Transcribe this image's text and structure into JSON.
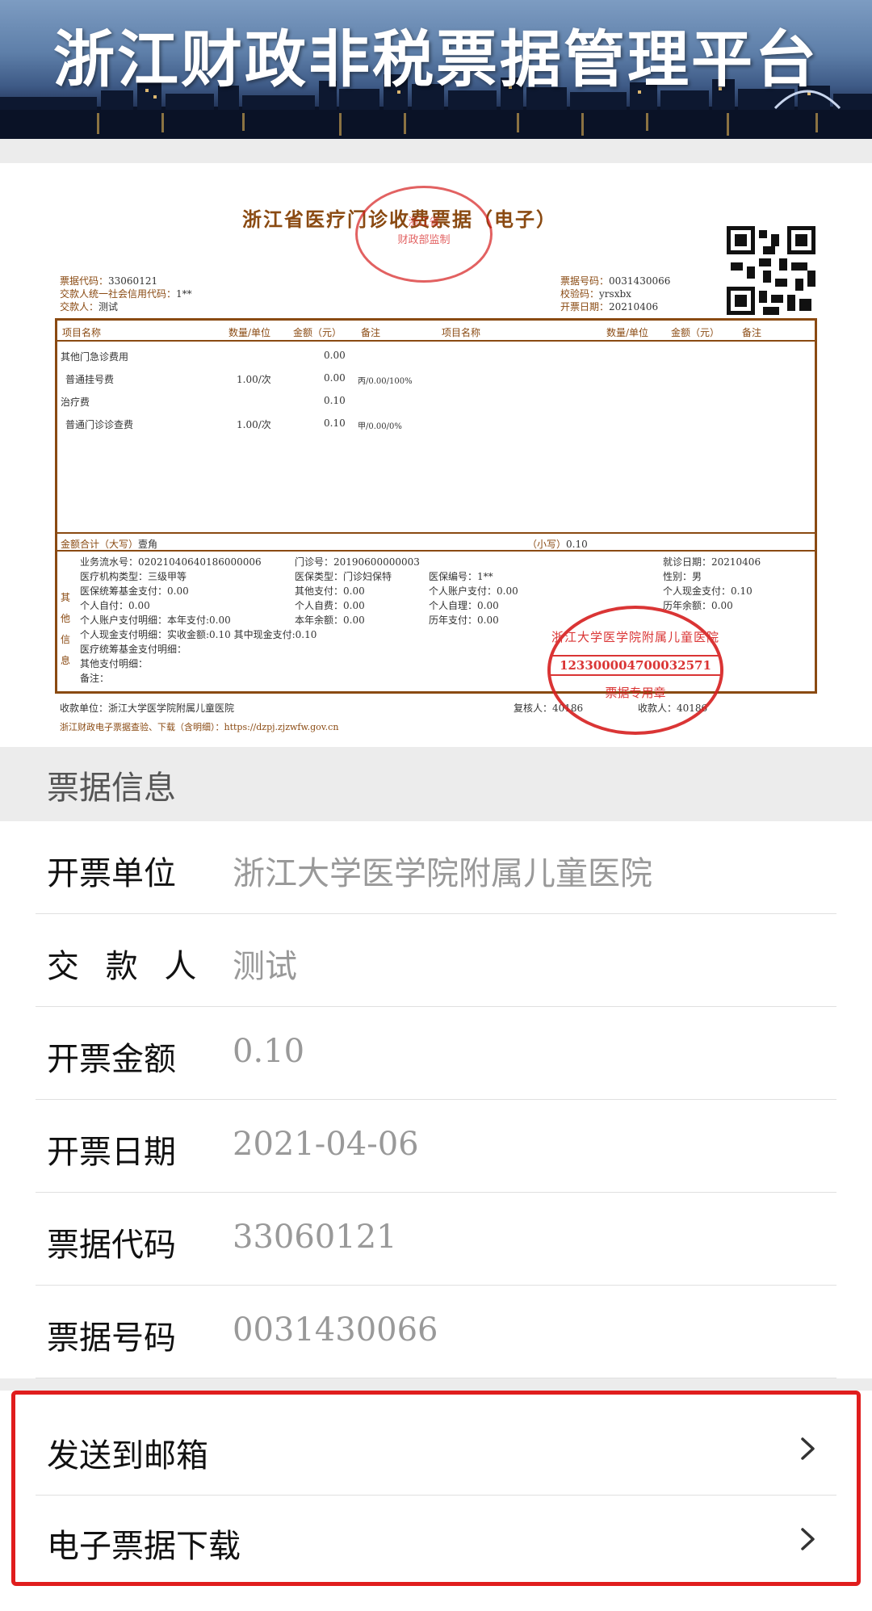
{
  "header": {
    "title": "浙江财政非税票据管理平台"
  },
  "receipt": {
    "title": "浙江省医疗门诊收费票据（电子）",
    "seal_top": {
      "text": "浙江省\n财政部监制"
    },
    "left_meta": [
      {
        "k": "票据代码：",
        "v": "33060121"
      },
      {
        "k": "交款人统一社会信用代码：",
        "v": "1**"
      },
      {
        "k": "交款人：",
        "v": "测试"
      }
    ],
    "right_meta": [
      {
        "k": "票据号码：",
        "v": "0031430066"
      },
      {
        "k": "校验码：",
        "v": "yrsxbx"
      },
      {
        "k": "开票日期：",
        "v": "20210406"
      }
    ],
    "table_headers": {
      "item": "项目名称",
      "qty": "数量/单位",
      "amount": "金额（元）",
      "note": "备注",
      "item2": "项目名称",
      "qty2": "数量/单位",
      "amount2": "金额（元）",
      "note2": "备注"
    },
    "rows": [
      {
        "name": "其他门急诊费用",
        "qty": "",
        "amount": "0.00",
        "note": ""
      },
      {
        "name": " 普通挂号费",
        "qty": "1.00/次",
        "amount": "0.00",
        "note": "丙/0.00/100%"
      },
      {
        "name": "治疗费",
        "qty": "",
        "amount": "0.10",
        "note": ""
      },
      {
        "name": " 普通门诊诊查费",
        "qty": "1.00/次",
        "amount": "0.10",
        "note": "甲/0.00/0%"
      }
    ],
    "total_upper_label": "金额合计（大写）",
    "total_upper": "壹角",
    "total_lower_label": "（小写）",
    "total_lower": "0.10",
    "other_label": "其他信息",
    "other_lines": [
      "业务流水号：02021040640186000006",
      "医疗机构类型：三级甲等",
      "医保统筹基金支付：0.00",
      "个人自付：0.00",
      "个人账户支付明细：本年支付:0.00",
      "个人现金支付明细：实收金额:0.10  其中现金支付:0.10",
      "医疗统筹基金支付明细：",
      "其他支付明细：",
      "备注："
    ],
    "mid_lines": [
      "门诊号：20190600000003",
      "医保类型：门诊妇保特",
      "其他支付：0.00",
      "个人自费：0.00",
      "本年余额：0.00"
    ],
    "mid2_lines": [
      "医保编号：1**",
      "个人账户支付：0.00",
      "个人自理：0.00",
      "历年支付：0.00"
    ],
    "right_lines": [
      "就诊日期：20210406",
      "性别：男",
      "个人现金支付：0.10",
      "历年余额：0.00"
    ],
    "payee": "收款单位：浙江大学医学院附属儿童医院",
    "reviewer": "复核人：40186",
    "issuer": "收款人：40186",
    "footer": "浙江财政电子票据查验、下载（含明细）：https://dzpj.zjzwfw.gov.cn",
    "seal_bottom": {
      "text": "浙江大学医学院附属儿童医院",
      "code": "123300004700032571",
      "sub": "票据专用章"
    }
  },
  "section_title": "票据信息",
  "info": [
    {
      "label": "开票单位",
      "value": "浙江大学医学院附属儿童医院"
    },
    {
      "label": "交 款 人",
      "value": "测试"
    },
    {
      "label": "开票金额",
      "value": "0.10"
    },
    {
      "label": "开票日期",
      "value": "2021-04-06"
    },
    {
      "label": "票据代码",
      "value": "33060121"
    },
    {
      "label": "票据号码",
      "value": "0031430066"
    }
  ],
  "actions": [
    {
      "label": "发送到邮箱",
      "icon": "chevron-right-icon"
    },
    {
      "label": "电子票据下载",
      "icon": "chevron-right-icon"
    }
  ],
  "colors": {
    "stamp": "#d61f1f",
    "receipt_brown": "#8a4a12",
    "highlight": "#e01d1d"
  }
}
